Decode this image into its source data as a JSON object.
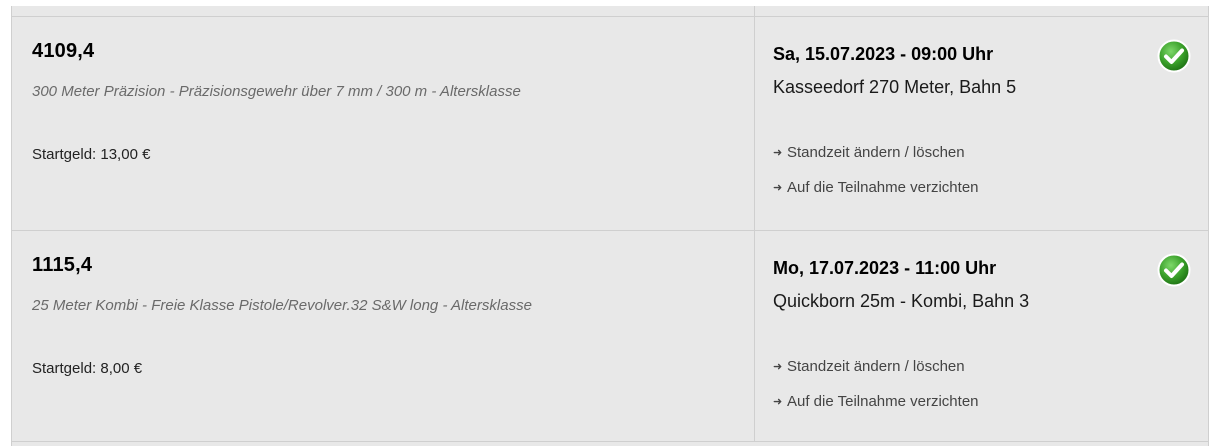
{
  "entries": [
    {
      "amount": "4109,4",
      "discipline": "300 Meter Präzision - Präzisionsgewehr über 7 mm / 300 m - Altersklasse",
      "fee": "Startgeld: 13,00 €",
      "datetime": "Sa, 15.07.2023 - 09:00 Uhr",
      "venue": "Kasseedorf 270 Meter, Bahn 5",
      "link_change": "Standzeit ändern / löschen",
      "link_withdraw": "Auf die Teilnahme verzichten",
      "status_icon": "check-circle-icon"
    },
    {
      "amount": "1115,4",
      "discipline": "25 Meter Kombi - Freie Klasse Pistole/Revolver.32 S&W long - Altersklasse",
      "fee": "Startgeld: 8,00 €",
      "datetime": "Mo, 17.07.2023 - 11:00 Uhr",
      "venue": "Quickborn 25m - Kombi, Bahn 3",
      "link_change": "Standzeit ändern / löschen",
      "link_withdraw": "Auf die Teilnahme verzichten",
      "status_icon": "check-circle-icon"
    }
  ],
  "colors": {
    "background": "#e8e8e8",
    "border": "#cfcfcf",
    "check_green": "#3aa02a",
    "muted_text": "#6a6a6a"
  }
}
